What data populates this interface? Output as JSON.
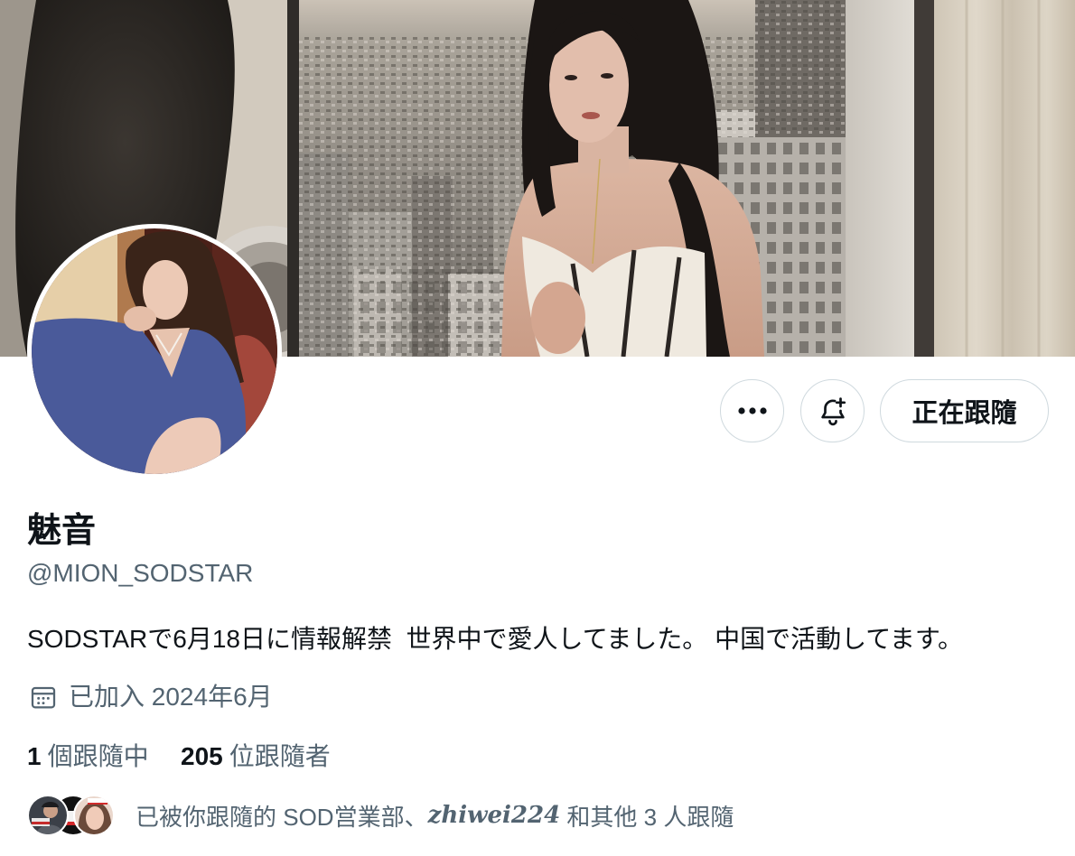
{
  "profile": {
    "display_name": "魅音",
    "handle": "@MION_SODSTAR",
    "bio": "SODSTARで6月18日に情報解禁  世界中で愛人してました。 中国で活動してます。",
    "joined": "已加入 2024年6月",
    "following_count": "1",
    "following_label": "個跟隨中",
    "followers_count": "205",
    "followers_label": "位跟隨者"
  },
  "actions": {
    "follow_state_label": "正在跟隨"
  },
  "followers_you_know": {
    "prefix": "已被你跟隨的 SOD営業部、",
    "highlighted_follower": "zhiwei224",
    "suffix": " 和其他 3 人跟隨"
  },
  "icons": {
    "more": "more-horizontal-icon",
    "notifications": "bell-plus-icon",
    "joined": "calendar-icon"
  },
  "colors": {
    "text_primary": "#0f1419",
    "text_secondary": "#536471",
    "button_border": "#cfd9de",
    "background": "#ffffff"
  }
}
